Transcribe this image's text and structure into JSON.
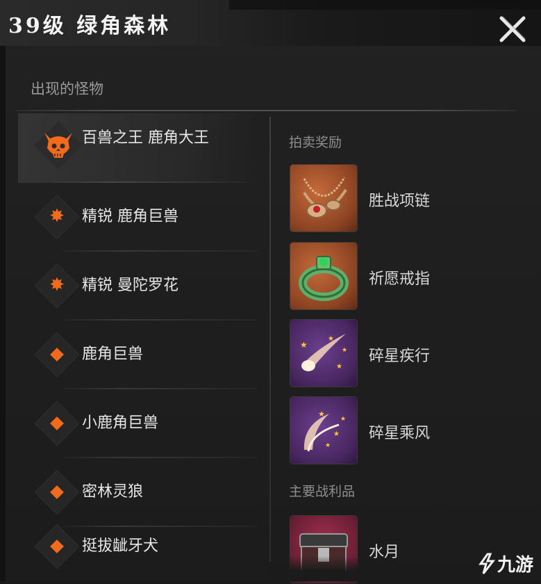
{
  "header": {
    "title": "39级 绿角森林"
  },
  "monsters_section": {
    "label": "出现的怪物"
  },
  "monsters": [
    {
      "name": "百兽之王 鹿角大王",
      "rank": "boss",
      "icon": "skull-icon"
    },
    {
      "name": "精锐 鹿角巨兽",
      "rank": "elite",
      "icon": "elite-star-icon"
    },
    {
      "name": "精锐 曼陀罗花",
      "rank": "elite",
      "icon": "elite-star-icon"
    },
    {
      "name": "鹿角巨兽",
      "rank": "normal",
      "icon": "diamond-icon"
    },
    {
      "name": "小鹿角巨兽",
      "rank": "normal",
      "icon": "diamond-icon"
    },
    {
      "name": "密林灵狼",
      "rank": "normal",
      "icon": "diamond-icon"
    },
    {
      "name": "挺拔龇牙犬",
      "rank": "normal",
      "icon": "diamond-icon"
    }
  ],
  "auction_section": {
    "label": "拍卖奖励"
  },
  "auction_rewards": [
    {
      "name": "胜战项链",
      "icon": "necklace-icon",
      "frame": "orange"
    },
    {
      "name": "祈愿戒指",
      "icon": "ring-icon",
      "frame": "orange"
    },
    {
      "name": "碎星疾行",
      "icon": "comet-icon",
      "frame": "purple"
    },
    {
      "name": "碎星乘风",
      "icon": "comet-wind-icon",
      "frame": "purple"
    }
  ],
  "loot_section": {
    "label": "主要战利品"
  },
  "loot": [
    {
      "name": "水月",
      "icon": "chest-icon",
      "frame": "crimson"
    }
  ],
  "watermark": {
    "text": "九游"
  },
  "colors": {
    "accent": "#f26a1b",
    "background": "#1f1f1f"
  }
}
